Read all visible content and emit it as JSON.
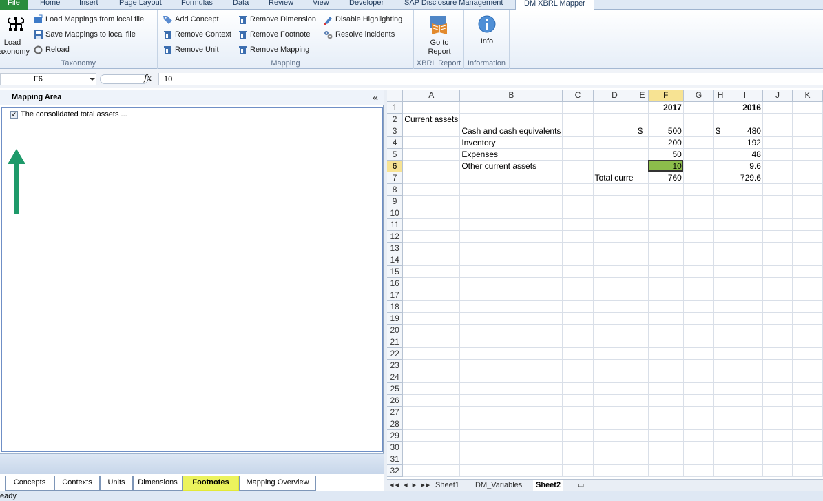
{
  "ribbon_tabs": [
    "File",
    "Home",
    "Insert",
    "Page Layout",
    "Formulas",
    "Data",
    "Review",
    "View",
    "Developer",
    "SAP Disclosure Management",
    "DM XBRL Mapper"
  ],
  "groups": {
    "taxonomy": {
      "label": "Taxonomy",
      "load_label": "Load\nTaxonomy",
      "load_mappings": "Load Mappings from local file",
      "save_mappings": "Save Mappings to local file",
      "reload": "Reload"
    },
    "mapping": {
      "label": "Mapping",
      "add_concept": "Add Concept",
      "remove_context": "Remove Context",
      "remove_unit": "Remove Unit",
      "remove_dimension": "Remove Dimension",
      "remove_footnote": "Remove Footnote",
      "remove_mapping": "Remove Mapping",
      "disable_highlighting": "Disable Highlighting",
      "resolve_incidents": "Resolve incidents"
    },
    "xbrl_report": {
      "label": "XBRL Report",
      "goto": "Go to\nReport"
    },
    "information": {
      "label": "Information",
      "info": "Info"
    }
  },
  "formula_bar": {
    "cell_ref": "F6",
    "fx": "fx",
    "value": "10"
  },
  "pane": {
    "title": "Mapping Area",
    "collapse": "«",
    "tree_item": "The consolidated total assets ...",
    "checked": true,
    "tabs": [
      "Concepts",
      "Contexts",
      "Units",
      "Dimensions",
      "Footnotes",
      "Mapping Overview"
    ],
    "active_tab": "Footnotes"
  },
  "grid": {
    "columns": [
      "A",
      "B",
      "C",
      "D",
      "E",
      "F",
      "G",
      "H",
      "I",
      "J",
      "K"
    ],
    "selected_column": "F",
    "selected_row": 6,
    "row_count": 32,
    "cells": {
      "1": {
        "F": "2017",
        "I": "2016"
      },
      "2": {
        "A": "Current assets"
      },
      "3": {
        "B": "Cash and cash equivalents",
        "E": "$",
        "F": "500",
        "H": "$",
        "I": "480"
      },
      "4": {
        "B": "Inventory",
        "F": "200",
        "I": "192"
      },
      "5": {
        "B": "Expenses",
        "F": "50",
        "I": "48"
      },
      "6": {
        "B": "Other current assets",
        "F": "10",
        "I": "9.6"
      },
      "7": {
        "D": "Total curre",
        "F": "760",
        "I": "729.6"
      }
    }
  },
  "sheets": [
    "Sheet1",
    "DM_Variables",
    "Sheet2"
  ],
  "active_sheet": "Sheet2",
  "status_text": "eady",
  "colors": {
    "accent": "#2a8c3c",
    "highlight": "#ecf35d",
    "arrow": "#1e9a6a",
    "cell_selected": "#8cbd4b"
  }
}
